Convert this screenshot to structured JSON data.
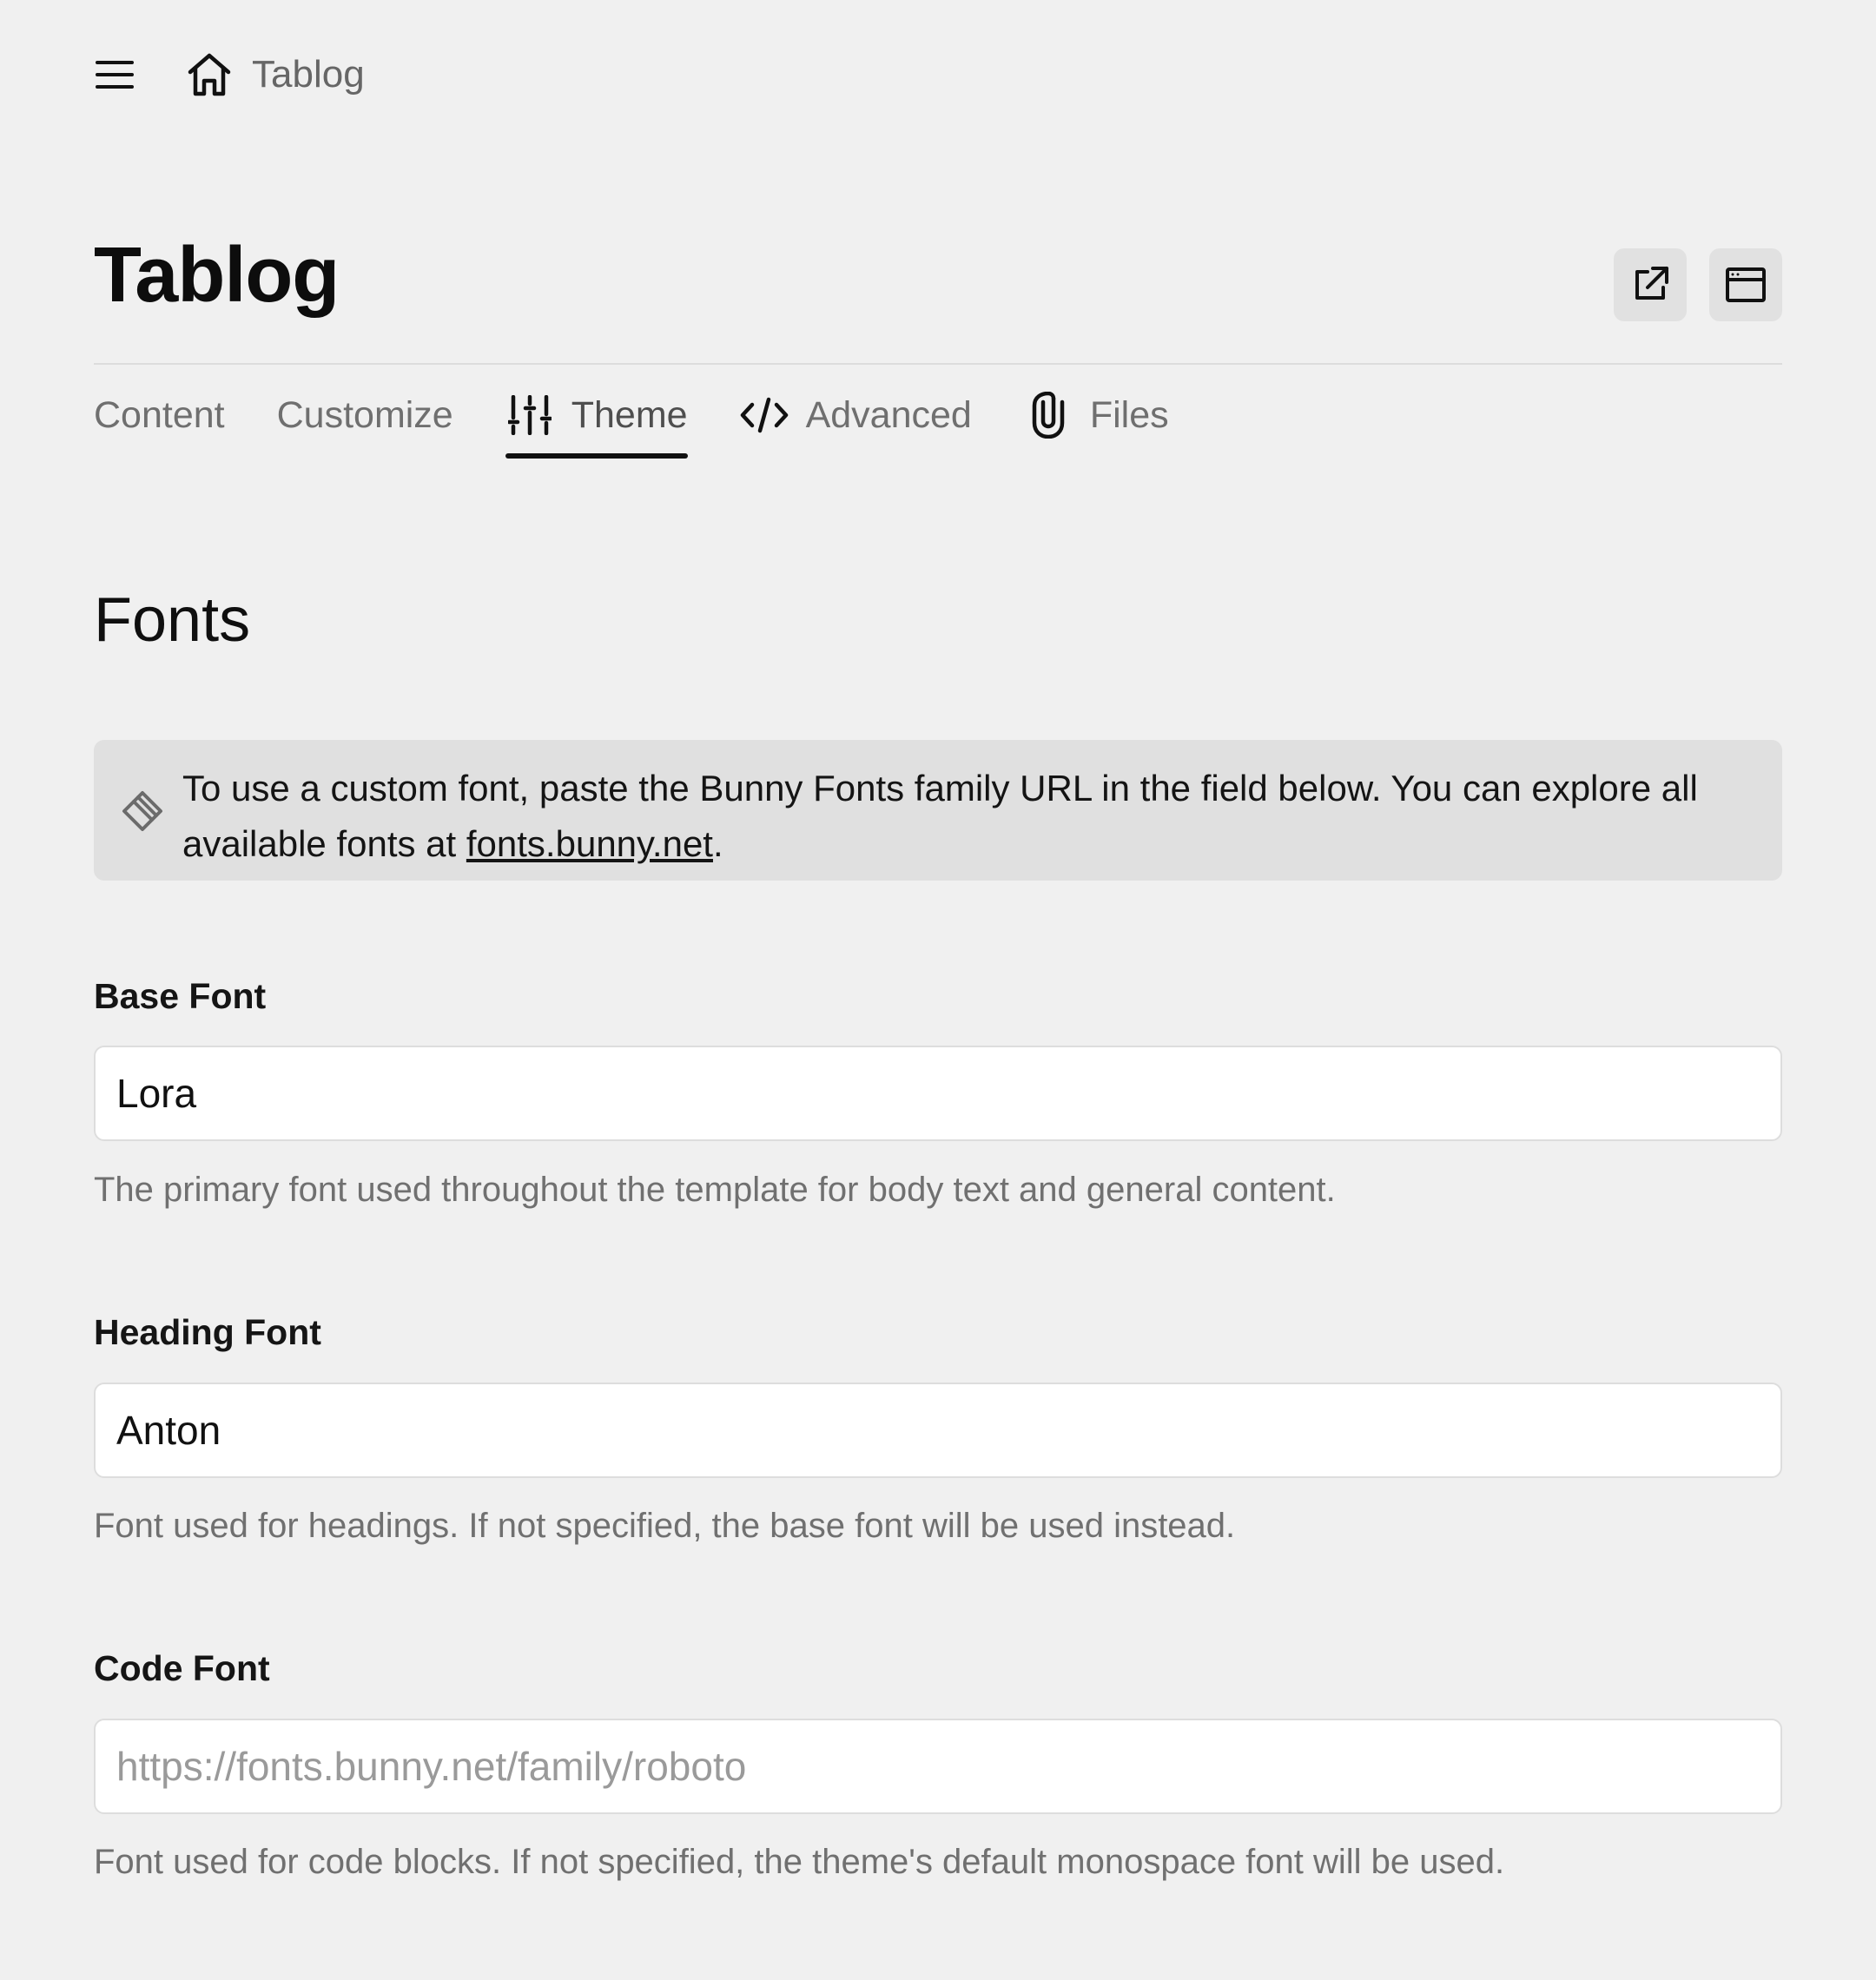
{
  "breadcrumb": {
    "label": "Tablog"
  },
  "page": {
    "title": "Tablog"
  },
  "tabs": [
    {
      "label": "Content",
      "icon": ""
    },
    {
      "label": "Customize",
      "icon": ""
    },
    {
      "label": "Theme",
      "icon": "sliders-icon",
      "active": true
    },
    {
      "label": "Advanced",
      "icon": "code-icon"
    },
    {
      "label": "Files",
      "icon": "paperclip-icon"
    }
  ],
  "section": {
    "title": "Fonts"
  },
  "notice": {
    "text_before": "To use a custom font, paste the Bunny Fonts family URL in the field below. You can explore all available fonts at ",
    "link_text": "fonts.bunny.net",
    "text_after": "."
  },
  "fields": {
    "base_font": {
      "label": "Base Font",
      "value": "Lora",
      "placeholder": "",
      "help": "The primary font used throughout the template for body text and general content."
    },
    "heading_font": {
      "label": "Heading Font",
      "value": "Anton",
      "placeholder": "",
      "help": "Font used for headings. If not specified, the base font will be used instead."
    },
    "code_font": {
      "label": "Code Font",
      "value": "",
      "placeholder": "https://fonts.bunny.net/family/roboto",
      "help": "Font used for code blocks. If not specified, the theme's default monospace font will be used."
    }
  }
}
